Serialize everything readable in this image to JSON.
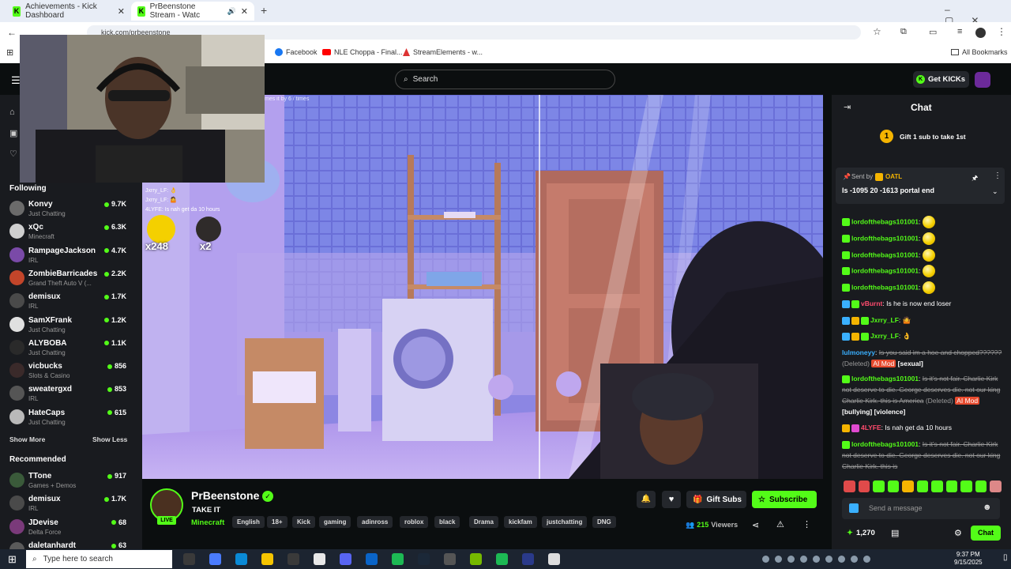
{
  "browser": {
    "tabs": [
      {
        "title": "Achievements - Kick Dashboard"
      },
      {
        "title": "PrBeenstone Stream - Watc"
      }
    ],
    "url": "kick.com/prbeenstone",
    "bookmarks": [
      {
        "label": "Facebook"
      },
      {
        "label": "NLE Choppa - Final..."
      },
      {
        "label": "StreamElements - w..."
      }
    ],
    "all_bookmarks": "All Bookmarks"
  },
  "header": {
    "search_placeholder": "Search",
    "get_kicks": "Get KICKs"
  },
  "sidebar": {
    "following_title": "Following",
    "following": [
      {
        "name": "Konvy",
        "category": "Just Chatting",
        "viewers": "9.7K",
        "color": "#6b6b6b"
      },
      {
        "name": "xQc",
        "category": "Minecraft",
        "viewers": "6.3K",
        "color": "#cfcfcf"
      },
      {
        "name": "RampageJackson",
        "category": "IRL",
        "viewers": "4.7K",
        "color": "#7a4aa8"
      },
      {
        "name": "ZombieBarricades",
        "category": "Grand Theft Auto V (...",
        "viewers": "2.2K",
        "color": "#c2452a"
      },
      {
        "name": "demisux",
        "category": "IRL",
        "viewers": "1.7K",
        "color": "#4a4a4a"
      },
      {
        "name": "SamXFrank",
        "category": "Just Chatting",
        "viewers": "1.2K",
        "color": "#e0e0e0"
      },
      {
        "name": "ALYBOBA",
        "category": "Just Chatting",
        "viewers": "1.1K",
        "color": "#2a2a2a"
      },
      {
        "name": "vicbucks",
        "category": "Slots & Casino",
        "viewers": "856",
        "color": "#3a2a2a"
      },
      {
        "name": "sweatergxd",
        "category": "IRL",
        "viewers": "853",
        "color": "#555555"
      },
      {
        "name": "HateCaps",
        "category": "Just Chatting",
        "viewers": "615",
        "color": "#b9b9b9"
      }
    ],
    "show_more": "Show More",
    "show_less": "Show Less",
    "recommended_title": "Recommended",
    "recommended": [
      {
        "name": "TTone",
        "category": "Games + Demos",
        "viewers": "917",
        "color": "#3a5a3a"
      },
      {
        "name": "demisux",
        "category": "IRL",
        "viewers": "1.7K",
        "color": "#4a4a4a"
      },
      {
        "name": "JDevise",
        "category": "Delta Force",
        "viewers": "68",
        "color": "#7a3a7a"
      },
      {
        "name": "daletanhardt",
        "category": "",
        "viewers": "63",
        "color": "#5a5a5a"
      }
    ]
  },
  "video": {
    "overlay_top": "mes it by 6 / times",
    "overlay_chat": [
      "Jxrry_LF: 👌",
      "Jxrry_LF: 🤷",
      "4LYFE: Is nah get da 10 hours"
    ],
    "overlay_counts": [
      "x248",
      "x2"
    ]
  },
  "stream": {
    "streamer": "PrBeenstone",
    "title": "TAKE IT",
    "category": "Minecraft",
    "tags": [
      "English",
      "18+",
      "Kick",
      "gaming",
      "adinross",
      "roblox",
      "black",
      "Drama",
      "kickfam",
      "justchatting",
      "DNG"
    ],
    "live_label": "LIVE",
    "gift_subs": "Gift Subs",
    "subscribe": "Subscribe",
    "viewers": "215",
    "viewers_label": "Viewers"
  },
  "chat": {
    "title": "Chat",
    "gift_rank": "1",
    "gift_prompt": "Gift 1 sub to take 1st",
    "pinned_sent_by": "Sent by",
    "pinned_user": "OATL",
    "pinned_text": "Is -1095 20 -1613 portal end",
    "messages": [
      {
        "user": "lordofthebags101001",
        "text": "",
        "emoji": true,
        "color": "#53fc18"
      },
      {
        "user": "lordofthebags101001",
        "text": "",
        "emoji": true,
        "color": "#53fc18"
      },
      {
        "user": "lordofthebags101001",
        "text": "",
        "emoji": true,
        "color": "#53fc18"
      },
      {
        "user": "lordofthebags101001",
        "text": "",
        "emoji": true,
        "color": "#53fc18"
      },
      {
        "user": "lordofthebags101001",
        "text": "",
        "emoji": true,
        "color": "#53fc18"
      },
      {
        "user": "vBurnt",
        "text": "Is he is now end loser",
        "color": "#ff4b6e"
      },
      {
        "user": "Jxrry_LF",
        "text": "🤷",
        "color": "#53fc18"
      },
      {
        "user": "Jxrry_LF",
        "text": "👌",
        "color": "#53fc18"
      }
    ],
    "deleted_1_user": "lulmoneyy",
    "deleted_1_text": "Is you said im a hoe and chopped??????",
    "deleted_label": "(Deleted)",
    "ai_mod": "AI Mod",
    "deleted_1_reason": "[sexual]",
    "deleted_2_user": "lordofthebags101001",
    "deleted_2_text": "Is it's not fair. Charlie Kirk not deserve to die. George deserves die. not our king Charlie Kirk. this is America",
    "deleted_2_reason": "[bullying] [violence]",
    "msg_4lyfe_user": "4LYFE",
    "msg_4lyfe_text": "Is nah get da 10 hours",
    "deleted_3_user": "lordofthebags101001",
    "deleted_3_text": "Is it's not fair. Charlie Kirk not deserve to die. George deserves die. not our king Charlie Kirk. this is",
    "input_placeholder": "Send a message",
    "kicks_balance": "1,270",
    "send": "Chat"
  },
  "taskbar": {
    "search_placeholder": "Type here to search",
    "time": "9:37 PM",
    "date": "9/15/2025"
  }
}
